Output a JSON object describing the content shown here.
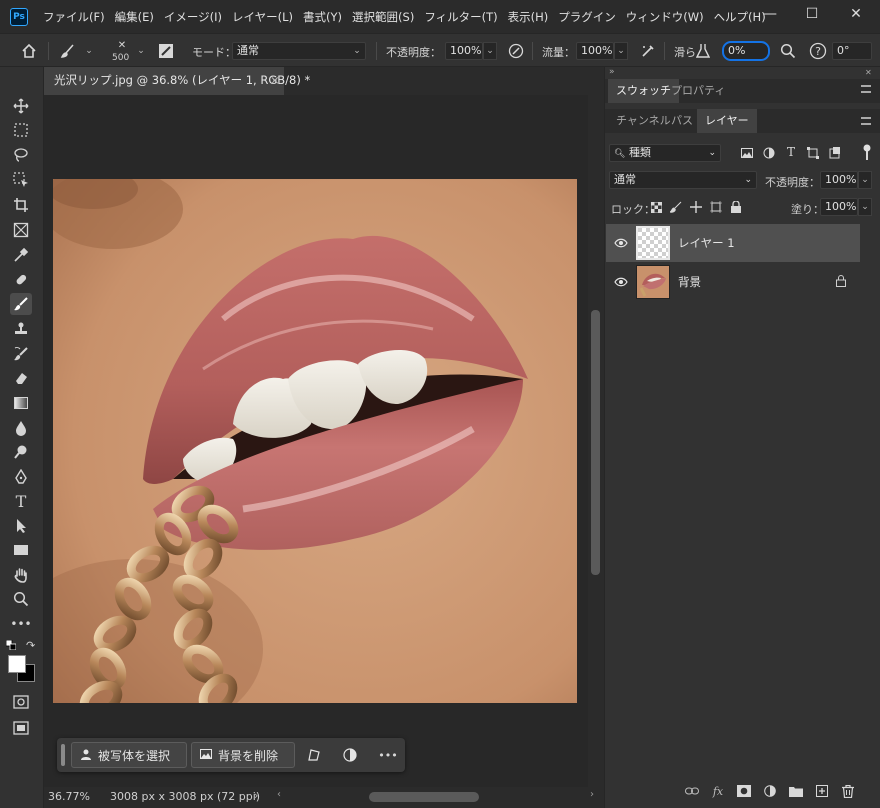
{
  "app": {
    "logo": "Ps",
    "menus": [
      "ファイル(F)",
      "編集(E)",
      "イメージ(I)",
      "レイヤー(L)",
      "書式(Y)",
      "選択範囲(S)",
      "フィルター(T)",
      "表示(H)",
      "プラグイン",
      "ウィンドウ(W)",
      "ヘルプ(H)"
    ],
    "window_controls": {
      "minimize": "—",
      "maximize": "☐",
      "close": "✕"
    }
  },
  "options": {
    "brush_size": "500",
    "mode_label": "モード：",
    "mode_value": "通常",
    "opacity_label": "不透明度：",
    "opacity_value": "100%",
    "flow_label": "流量：",
    "flow_value": "100%",
    "smoothing_label": "滑ら",
    "smoothing_value": "0%",
    "angle_value": "0°"
  },
  "document": {
    "tab_title": "光沢リップ.jpg @ 36.8% (レイヤー 1, RGB/8) *",
    "tab_close": "×"
  },
  "context_bar": {
    "select_subject": "被写体を選択",
    "remove_bg": "背景を削除",
    "more": "•••"
  },
  "status": {
    "zoom": "36.77%",
    "doc_info": "3008 px x 3008 px (72 ppi)",
    "arrow": "›"
  },
  "panels": {
    "top_tabs": [
      "スウォッチ",
      "プロパティ"
    ],
    "bottom_tabs": [
      "チャンネル",
      "パス",
      "レイヤー"
    ],
    "filter_kind": "種類",
    "blend_mode": "通常",
    "opacity_label": "不透明度：",
    "opacity_value": "100%",
    "lock_label": "ロック：",
    "fill_label": "塗り：",
    "fill_value": "100%",
    "layers": [
      {
        "name": "レイヤー 1",
        "selected": true,
        "locked": false
      },
      {
        "name": "背景",
        "selected": false,
        "locked": true
      }
    ]
  },
  "colors": {
    "accent_focus": "#1473e6",
    "menubar_bg": "#2b2b2b",
    "panel_bg": "#323232",
    "canvas_bg": "#282828"
  }
}
